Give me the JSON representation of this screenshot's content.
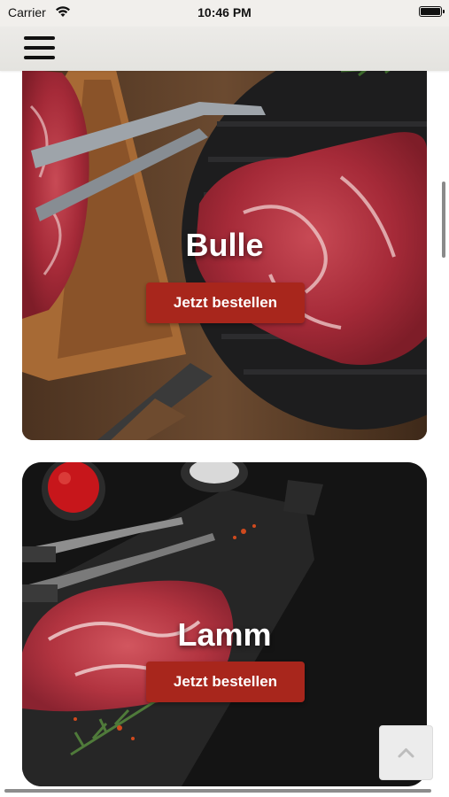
{
  "status_bar": {
    "carrier": "Carrier",
    "time": "10:46 PM"
  },
  "header": {
    "menu_icon": "hamburger-menu-icon"
  },
  "products": [
    {
      "name": "Bulle",
      "button_label": "Jetzt bestellen"
    },
    {
      "name": "Lamm",
      "button_label": "Jetzt bestellen"
    }
  ],
  "scroll_top_icon": "chevron-up-icon",
  "colors": {
    "button": "#a8261c",
    "header": "#ecebe8"
  }
}
